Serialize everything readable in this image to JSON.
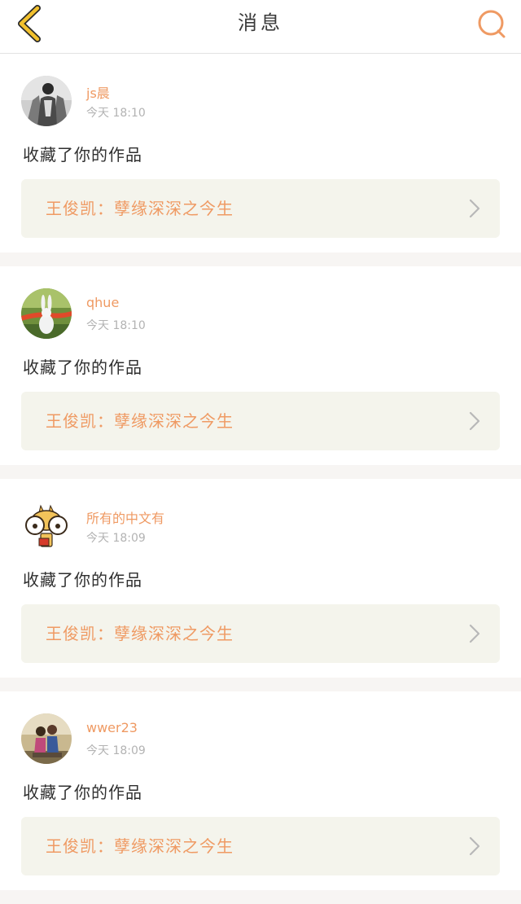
{
  "header": {
    "title": "消息"
  },
  "messages": [
    {
      "username": "js晨",
      "time": "今天 18:10",
      "action": "收藏了你的作品",
      "work_title": "王俊凯：孽缘深深之今生",
      "avatar": "avatar-photo-man"
    },
    {
      "username": "qhue",
      "time": "今天 18:10",
      "action": "收藏了你的作品",
      "work_title": "王俊凯：孽缘深深之今生",
      "avatar": "avatar-photo-rabbit"
    },
    {
      "username": "所有的中文有",
      "time": "今天 18:09",
      "action": "收藏了你的作品",
      "work_title": "王俊凯：孽缘深深之今生",
      "avatar": "avatar-cartoon-giraffe"
    },
    {
      "username": "wwer23",
      "time": "今天 18:09",
      "action": "收藏了你的作品",
      "work_title": "王俊凯：孽缘深深之今生",
      "avatar": "avatar-photo-couple"
    }
  ],
  "colors": {
    "accent": "#ef9a63",
    "back_icon": "#f2c12e",
    "card_bg": "#ffffff",
    "work_bg": "#f4f4ec",
    "page_bg": "#f7f5f3"
  }
}
